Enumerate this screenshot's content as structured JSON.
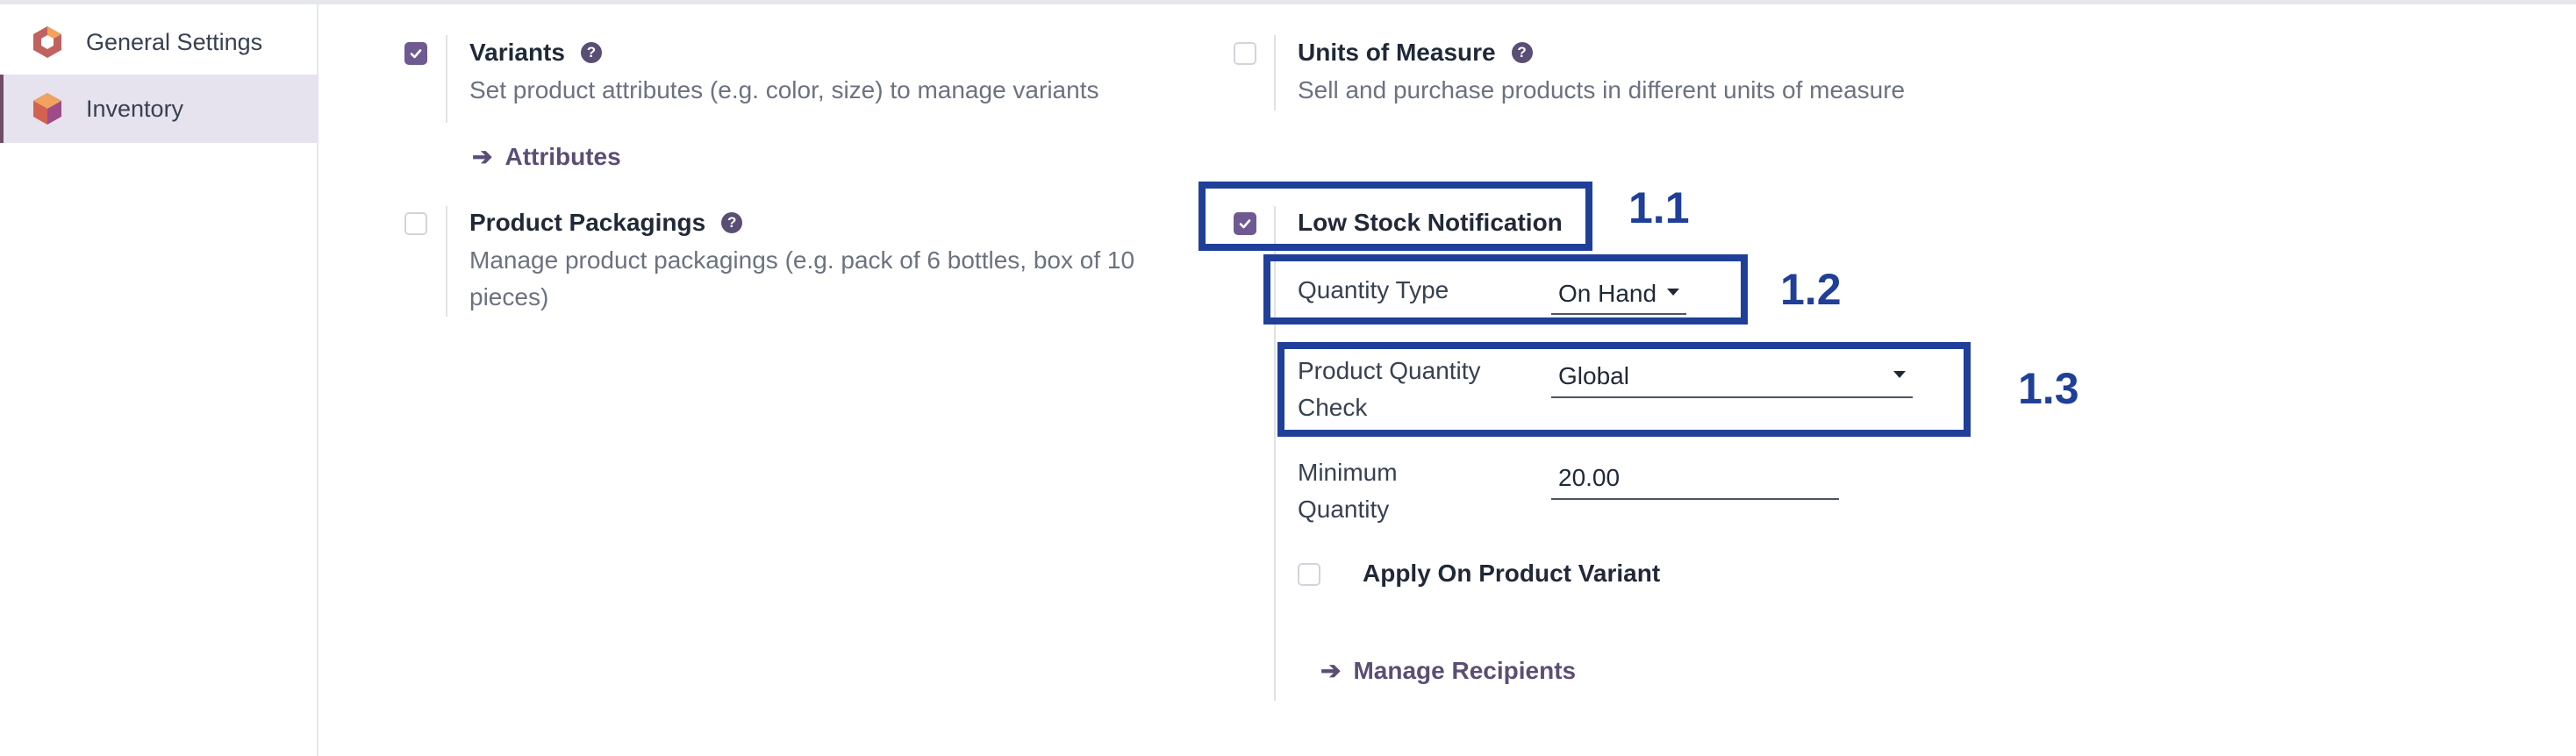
{
  "sidebar": {
    "items": [
      {
        "label": "General Settings",
        "icon": "odoo-general-settings-icon"
      },
      {
        "label": "Inventory",
        "icon": "inventory-app-icon"
      }
    ]
  },
  "settings": {
    "variants": {
      "title": "Variants",
      "description": "Set product attributes (e.g. color, size) to manage variants",
      "checked": true,
      "link": "Attributes"
    },
    "units_of_measure": {
      "title": "Units of Measure",
      "description": "Sell and purchase products in different units of measure",
      "checked": false
    },
    "product_packagings": {
      "title": "Product Packagings",
      "description": "Manage product packagings (e.g. pack of 6 bottles, box of 10 pieces)",
      "checked": false
    },
    "low_stock": {
      "title": "Low Stock Notification",
      "checked": true,
      "quantity_type_label": "Quantity Type",
      "quantity_type_value": "On Hand",
      "product_quantity_check_label": "Product Quantity Check",
      "product_quantity_check_value": "Global",
      "minimum_quantity_label": "Minimum Quantity",
      "minimum_quantity_value": "20.00",
      "apply_variant_label": "Apply On Product Variant",
      "apply_variant_checked": false,
      "manage_recipients_link": "Manage Recipients"
    }
  },
  "annotations": {
    "n1": "1.1",
    "n2": "1.2",
    "n3": "1.3"
  },
  "colors": {
    "accent": "#6e5a91",
    "annotation": "#1f3f99",
    "sidebar_active": "#e6e2ee"
  }
}
